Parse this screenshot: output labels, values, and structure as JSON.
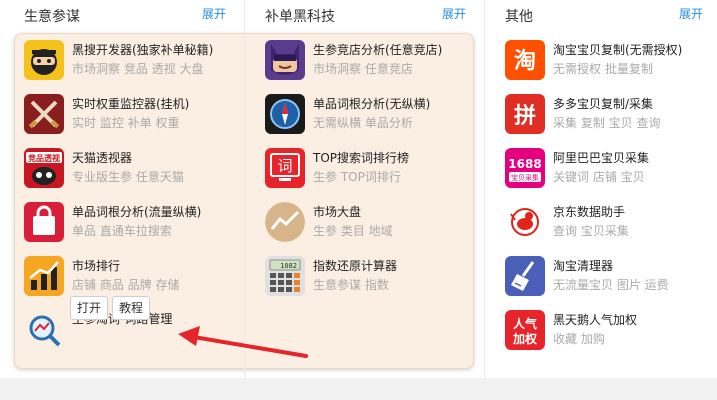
{
  "columns": [
    {
      "title": "生意参谋",
      "expand": "展开"
    },
    {
      "title": "补单黑科技",
      "expand": "展开"
    },
    {
      "title": "其他",
      "expand": "展开"
    }
  ],
  "col1_items": [
    {
      "name": "黑搜开发器(独家补单秘籍)",
      "desc": "市场洞察 竞品 透视 大盘",
      "icon": "ninja-icon"
    },
    {
      "name": "实时权重监控器(挂机)",
      "desc": "实时 监控 补单 权重",
      "icon": "crossed-swords-icon"
    },
    {
      "name": "天猫透视器",
      "desc": "专业版生参 任意天猫",
      "icon": "tmall-perspective-icon",
      "badge": "竞品透视"
    },
    {
      "name": "单品词根分析(流量纵横)",
      "desc": "单品 直通车拉搜索",
      "icon": "shopping-bag-icon"
    },
    {
      "name": "市场排行",
      "desc": "店铺 商品 品牌 存储",
      "icon": "bar-chart-icon"
    },
    {
      "name": "生参淘词-词路管理",
      "desc": "",
      "icon": "magnifier-icon"
    }
  ],
  "col2_items": [
    {
      "name": "生参竞店分析(任意竞店)",
      "desc": "市场洞察 任意竞店",
      "icon": "masked-hero-icon"
    },
    {
      "name": "单品词根分析(无纵横)",
      "desc": "无需纵横 单品分析",
      "icon": "compass-icon"
    },
    {
      "name": "TOP搜索词排行榜",
      "desc": "生参 TOP词排行",
      "icon": "ci-rank-icon",
      "glyph": "词"
    },
    {
      "name": "市场大盘",
      "desc": "生参 类目 地域",
      "icon": "trend-icon"
    },
    {
      "name": "指数还原计算器",
      "desc": "生意参谋 指数",
      "icon": "calculator-icon",
      "display": "1082"
    }
  ],
  "col3_items": [
    {
      "name": "淘宝宝贝复制(无需授权)",
      "desc": "无需授权 批量复制",
      "icon": "taobao-icon",
      "glyph": "淘"
    },
    {
      "name": "多多宝贝复制/采集",
      "desc": "采集 复制 宝贝 查询",
      "icon": "pinduoduo-icon",
      "glyph": "拼"
    },
    {
      "name": "阿里巴巴宝贝采集",
      "desc": "关键词 店铺 宝贝",
      "icon": "alibaba-1688-icon",
      "glyph": "1688",
      "sub": "宝贝采集"
    },
    {
      "name": "京东数据助手",
      "desc": "查询 宝贝采集",
      "icon": "jd-dog-icon"
    },
    {
      "name": "淘宝清理器",
      "desc": "无流量宝贝 图片 运费",
      "icon": "broom-icon"
    },
    {
      "name": "黑天鹅人气加权",
      "desc": "收藏 加购",
      "icon": "popularity-icon",
      "glyph": "人气",
      "sub": "加权"
    }
  ],
  "actions": {
    "open": "打开",
    "tutorial": "教程"
  },
  "colors": {
    "accent": "#2a8fe0",
    "highlight_bg": "#fbefe4",
    "arrow": "#e8242b"
  }
}
